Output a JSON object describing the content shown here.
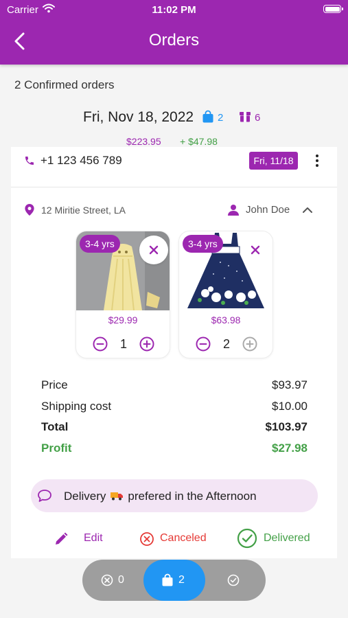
{
  "status_bar": {
    "carrier": "Carrier",
    "time": "11:02 PM"
  },
  "header": {
    "title": "Orders",
    "back_icon": "back-arrow-icon"
  },
  "summary": "2 Confirmed orders",
  "date_group": {
    "date": "Fri, Nov 18, 2022",
    "bag_count": "2",
    "box_count": "6",
    "revenue": "$223.95",
    "profit": "+ $47.98"
  },
  "order": {
    "phone": "+1 123 456 789",
    "date_badge": "Fri, 11/18",
    "address": "12 Miritie Street, LA",
    "customer": "John Doe",
    "items": [
      {
        "age": "3-4 yrs",
        "price": "$29.99",
        "qty": "1"
      },
      {
        "age": "3-4 yrs",
        "price": "$63.98",
        "qty": "2"
      }
    ],
    "price_label": "Price",
    "price_value": "$93.97",
    "shipping_label": "Shipping cost",
    "shipping_value": "$10.00",
    "total_label": "Total",
    "total_value": "$103.97",
    "profit_label": "Profit",
    "profit_value": "$27.98",
    "delivery_prefix": "Delivery",
    "delivery_suffix": "prefered in the Afternoon",
    "actions": {
      "edit": "Edit",
      "canceled": "Canceled",
      "delivered": "Delivered"
    }
  },
  "bottom_tabs": {
    "canceled_count": "0",
    "orders_count": "2"
  },
  "colors": {
    "primary": "#9c27b0",
    "accent": "#2196f3",
    "success": "#43a047",
    "danger": "#e53935"
  }
}
